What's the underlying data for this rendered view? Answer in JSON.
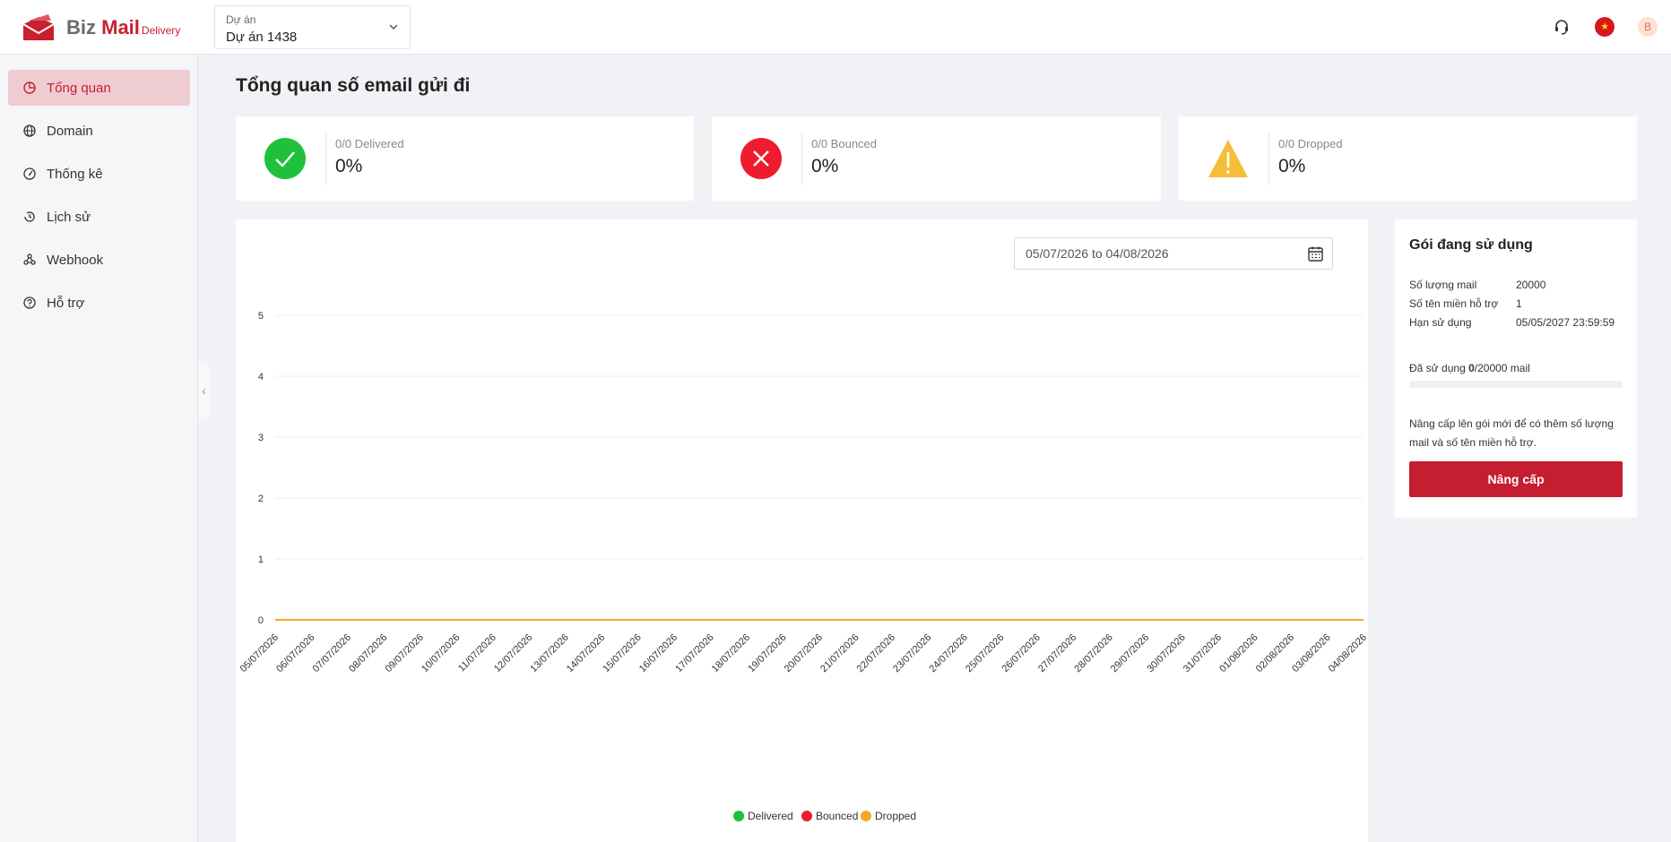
{
  "header": {
    "logo": {
      "biz": "Biz",
      "mail": "Mail",
      "delivery": "Delivery"
    },
    "project_label": "Dự án",
    "project_value": "Dự án 1438",
    "avatar_letter": "B"
  },
  "sidebar": {
    "items": [
      {
        "label": "Tổng quan",
        "icon": "pie-chart-icon",
        "active": true
      },
      {
        "label": "Domain",
        "icon": "globe-icon"
      },
      {
        "label": "Thống kê",
        "icon": "gauge-icon"
      },
      {
        "label": "Lịch sử",
        "icon": "history-icon"
      },
      {
        "label": "Webhook",
        "icon": "webhook-icon"
      },
      {
        "label": "Hỗ trợ",
        "icon": "help-icon"
      }
    ]
  },
  "main": {
    "title": "Tổng quan số email gửi đi",
    "stats": [
      {
        "label": "0/0 Delivered",
        "value": "0%",
        "color": "#1fc13b"
      },
      {
        "label": "0/0 Bounced",
        "value": "0%",
        "color": "#ee1c2e"
      },
      {
        "label": "0/0 Dropped",
        "value": "0%",
        "color": "#f5bd3a"
      }
    ],
    "date_range": "05/07/2026 to 04/08/2026"
  },
  "plan": {
    "title": "Gói đang sử dụng",
    "rows": [
      {
        "label": "Số lượng mail",
        "value": "20000"
      },
      {
        "label": "Số tên miền hỗ trợ",
        "value": "1"
      },
      {
        "label": "Hạn sử dụng",
        "value": "05/05/2027 23:59:59"
      }
    ],
    "used_prefix": "Đã sử dụng ",
    "used_count": "0",
    "used_suffix": "/20000 mail",
    "used_fraction": 0,
    "note": "Nâng cấp lên gói mới để có thêm số lượng mail và số tên miền hỗ trợ.",
    "button": "Nâng cấp"
  },
  "chart_data": {
    "type": "line",
    "x": [
      "05/07/2026",
      "06/07/2026",
      "07/07/2026",
      "08/07/2026",
      "09/07/2026",
      "10/07/2026",
      "11/07/2026",
      "12/07/2026",
      "13/07/2026",
      "14/07/2026",
      "15/07/2026",
      "16/07/2026",
      "17/07/2026",
      "18/07/2026",
      "19/07/2026",
      "20/07/2026",
      "21/07/2026",
      "22/07/2026",
      "23/07/2026",
      "24/07/2026",
      "25/07/2026",
      "26/07/2026",
      "27/07/2026",
      "28/07/2026",
      "29/07/2026",
      "30/07/2026",
      "31/07/2026",
      "01/08/2026",
      "02/08/2026",
      "03/08/2026",
      "04/08/2026"
    ],
    "series": [
      {
        "name": "Delivered",
        "color": "#1fc13b",
        "values": [
          0,
          0,
          0,
          0,
          0,
          0,
          0,
          0,
          0,
          0,
          0,
          0,
          0,
          0,
          0,
          0,
          0,
          0,
          0,
          0,
          0,
          0,
          0,
          0,
          0,
          0,
          0,
          0,
          0,
          0,
          0
        ]
      },
      {
        "name": "Bounced",
        "color": "#ee1c2e",
        "values": [
          0,
          0,
          0,
          0,
          0,
          0,
          0,
          0,
          0,
          0,
          0,
          0,
          0,
          0,
          0,
          0,
          0,
          0,
          0,
          0,
          0,
          0,
          0,
          0,
          0,
          0,
          0,
          0,
          0,
          0,
          0
        ]
      },
      {
        "name": "Dropped",
        "color": "#f5a623",
        "values": [
          0,
          0,
          0,
          0,
          0,
          0,
          0,
          0,
          0,
          0,
          0,
          0,
          0,
          0,
          0,
          0,
          0,
          0,
          0,
          0,
          0,
          0,
          0,
          0,
          0,
          0,
          0,
          0,
          0,
          0,
          0
        ]
      }
    ],
    "ylim": [
      0,
      5
    ],
    "yticks": [
      0,
      1,
      2,
      3,
      4,
      5
    ],
    "grid": true,
    "legend": "bottom"
  }
}
